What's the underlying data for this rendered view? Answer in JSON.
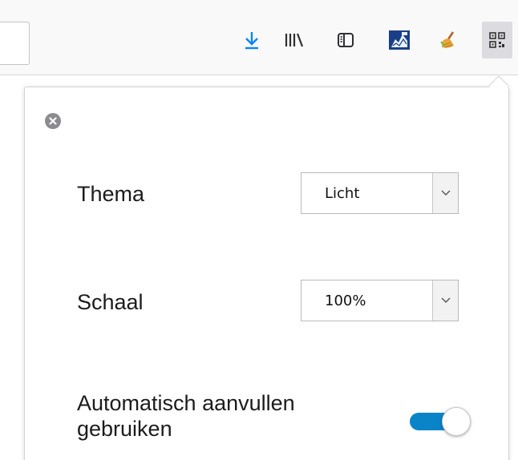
{
  "toolbar": {
    "icons": [
      "download-arrow-icon",
      "library-icon",
      "sidebar-icon",
      "extension-puzzle-icon",
      "broom-cleaner-icon",
      "qr-code-icon"
    ],
    "active_icon": "qr-code-icon",
    "download_color": "#0a84ff"
  },
  "panel": {
    "close_icon": "close-circle-icon",
    "settings": {
      "theme_label": "Thema",
      "theme_value": "Licht",
      "scale_label": "Schaal",
      "scale_value": "100%",
      "autofill_label_line1": "Automatisch aanvullen",
      "autofill_label_line2": "gebruiken",
      "autofill_enabled": true
    },
    "accent_color": "#0a84c8"
  }
}
